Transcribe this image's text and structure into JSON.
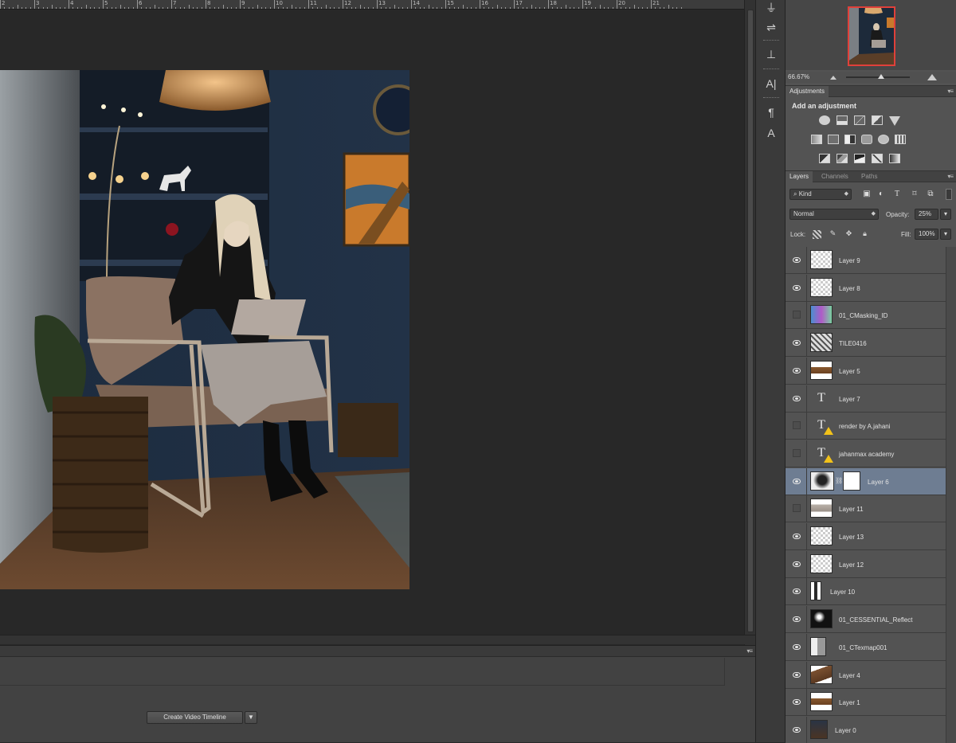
{
  "ruler": {
    "numbers": [
      "2",
      "3",
      "4",
      "5",
      "6",
      "7",
      "8",
      "9",
      "10",
      "11",
      "12",
      "13",
      "14",
      "15",
      "16",
      "17",
      "18",
      "19",
      "20",
      "21"
    ]
  },
  "navigator": {
    "zoom": "66.67%"
  },
  "adjustments": {
    "tab": "Adjustments",
    "title": "Add an adjustment",
    "icons_row1": [
      "brightness-contrast-icon",
      "levels-icon",
      "curves-icon",
      "exposure-icon",
      "vibrance-icon"
    ],
    "icons_row2": [
      "hue-saturation-icon",
      "color-balance-icon",
      "black-white-icon",
      "photo-filter-icon",
      "channel-mixer-icon",
      "color-lookup-icon"
    ],
    "icons_row3": [
      "invert-icon",
      "posterize-icon",
      "threshold-icon",
      "selective-color-icon",
      "gradient-map-icon"
    ]
  },
  "layers_panel": {
    "tabs": [
      "Layers",
      "Channels",
      "Paths"
    ],
    "active_tab": "Layers",
    "filter_kind": "Kind",
    "blend_mode": "Normal",
    "opacity_label": "Opacity:",
    "opacity": "25%",
    "lock_label": "Lock:",
    "fill_label": "Fill:",
    "fill": "100%",
    "layers": [
      {
        "name": "Layer 9",
        "visible": true,
        "thumb": "transparent"
      },
      {
        "name": "Layer 8",
        "visible": true,
        "thumb": "transparent"
      },
      {
        "name": "01_CMasking_ID",
        "visible": false,
        "thumb": "mask-id"
      },
      {
        "name": "TILE0416",
        "visible": true,
        "thumb": "tile"
      },
      {
        "name": "Layer 5",
        "visible": true,
        "thumb": "strip"
      },
      {
        "name": "Layer 7",
        "visible": true,
        "thumb": "text"
      },
      {
        "name": "render by A.jahani",
        "visible": false,
        "thumb": "text-warn"
      },
      {
        "name": "jahanmax academy",
        "visible": false,
        "thumb": "text-warn"
      },
      {
        "name": "Layer 6",
        "visible": true,
        "thumb": "masked",
        "selected": true
      },
      {
        "name": "Layer 11",
        "visible": false,
        "thumb": "strip-light"
      },
      {
        "name": "Layer 13",
        "visible": true,
        "thumb": "transparent"
      },
      {
        "name": "Layer 12",
        "visible": true,
        "thumb": "transparent"
      },
      {
        "name": "Layer 10",
        "visible": true,
        "thumb": "figure"
      },
      {
        "name": "01_CESSENTIAL_Reflect",
        "visible": true,
        "thumb": "dark"
      },
      {
        "name": "01_CTexmap001",
        "visible": true,
        "thumb": "texmap"
      },
      {
        "name": "Layer 4",
        "visible": true,
        "thumb": "brown"
      },
      {
        "name": "Layer 1",
        "visible": true,
        "thumb": "strip"
      },
      {
        "name": "Layer 0",
        "visible": true,
        "thumb": "photo"
      }
    ]
  },
  "timeline": {
    "create_button": "Create Video Timeline"
  },
  "colors": {
    "selected_layer": "#6e7d92",
    "navigator_frame": "#e0403a",
    "warning": "#f2c21a"
  }
}
